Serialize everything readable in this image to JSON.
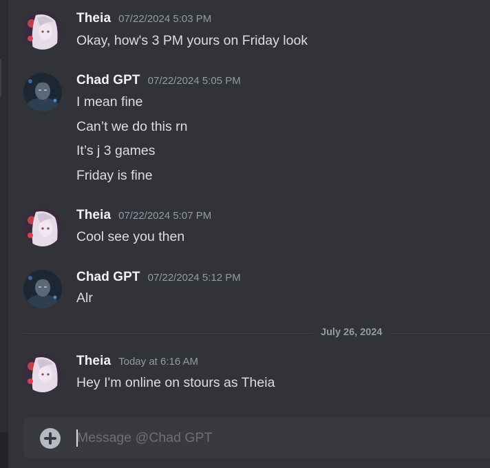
{
  "messages": [
    {
      "author": "Theia",
      "timestamp": "07/22/2024 5:03 PM",
      "avatar_icon": "anime-girl-avatar",
      "lines": [
        "Okay, how's 3 PM yours on Friday look"
      ]
    },
    {
      "author": "Chad GPT",
      "timestamp": "07/22/2024 5:05 PM",
      "avatar_icon": "hero-avatar",
      "lines": [
        "I mean fine",
        "Can’t we do this rn",
        "It’s j 3 games",
        "Friday is fine"
      ]
    },
    {
      "author": "Theia",
      "timestamp": "07/22/2024 5:07 PM",
      "avatar_icon": "anime-girl-avatar",
      "lines": [
        "Cool see you then"
      ]
    },
    {
      "author": "Chad GPT",
      "timestamp": "07/22/2024 5:12 PM",
      "avatar_icon": "hero-avatar",
      "lines": [
        "Alr"
      ]
    },
    {
      "author": "Theia",
      "timestamp": "Today at 6:16 AM",
      "avatar_icon": "anime-girl-avatar",
      "lines": [
        "Hey I'm online on stours as Theia"
      ]
    }
  ],
  "date_divider": "July 26, 2024",
  "composer": {
    "placeholder": "Message @Chad GPT",
    "value": "",
    "add_icon": "plus-circle-icon"
  },
  "colors": {
    "background": "#313338",
    "text": "#dbdee1",
    "username": "#f2f3f5",
    "muted": "#949ba4",
    "composer": "#383a40"
  }
}
